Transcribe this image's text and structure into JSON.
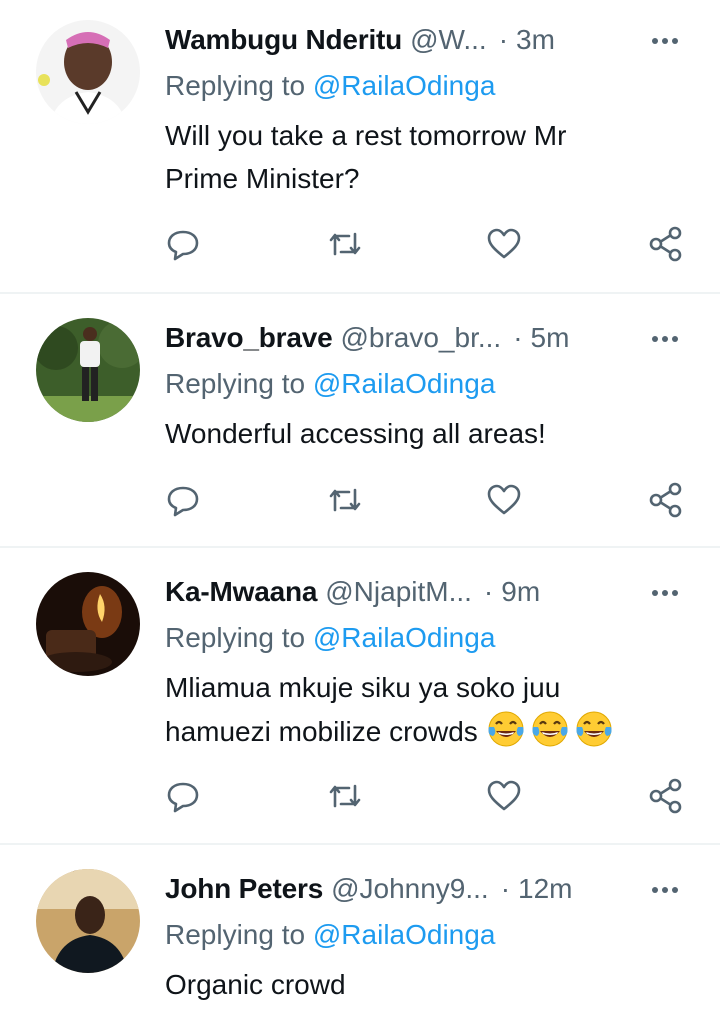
{
  "tweets": [
    {
      "name": "Wambugu Nderitu",
      "handle": "@W...",
      "sep": "·",
      "time": "3m",
      "replying_prefix": "Replying to ",
      "replying_to": "@RailaOdinga",
      "text": "Will you take a rest tomorrow Mr Prime Minister?",
      "text_line1": "Will you take a rest tomorrow Mr",
      "text_line2": "Prime Minister?"
    },
    {
      "name": "Bravo_brave",
      "handle": "@bravo_br...",
      "sep": "·",
      "time": "5m",
      "replying_prefix": "Replying to ",
      "replying_to": "@RailaOdinga",
      "text": "Wonderful accessing all areas!"
    },
    {
      "name": "Ka-Mwaana",
      "handle": "@NjapitM...",
      "sep": "·",
      "time": "9m",
      "replying_prefix": "Replying to ",
      "replying_to": "@RailaOdinga",
      "text_line1": "Mliamua mkuje siku ya soko juu",
      "text_line2": "hamuezi mobilize crowds",
      "emoji": [
        "face-with-tears-of-joy-icon",
        "face-with-tears-of-joy-icon",
        "face-with-tears-of-joy-icon"
      ]
    },
    {
      "name": "John Peters",
      "handle": "@Johnny9...",
      "sep": "·",
      "time": "12m",
      "replying_prefix": "Replying to ",
      "replying_to": "@RailaOdinga",
      "text": "Organic crowd"
    }
  ],
  "icons": {
    "reply": "reply-icon",
    "retweet": "retweet-icon",
    "like": "like-icon",
    "share": "share-icon",
    "more": "more-icon"
  },
  "colors": {
    "mention": "#1d9bf0",
    "secondary_text": "#536471",
    "primary_text": "#0f1419",
    "divider": "#eff3f4"
  }
}
